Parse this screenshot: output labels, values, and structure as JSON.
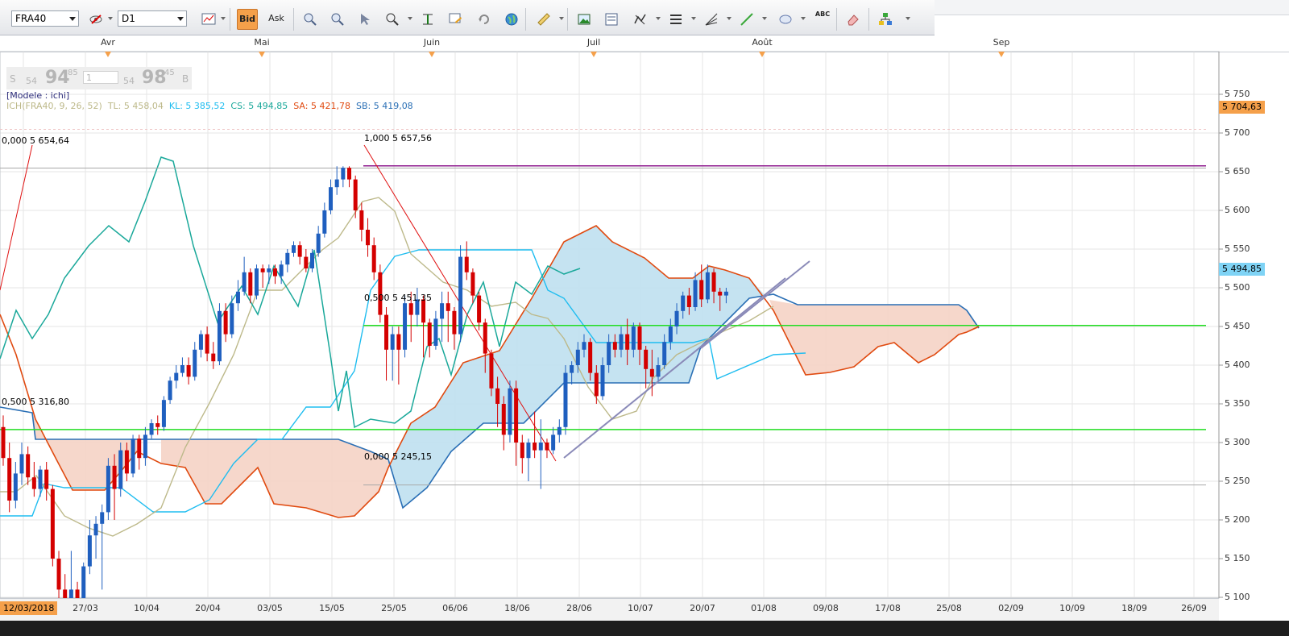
{
  "toolbar": {
    "symbol": "FRA40",
    "timeframe": "D1",
    "bid_label": "Bid",
    "ask_label": "Ask",
    "text_tool_label": "ABC"
  },
  "quote": {
    "sell_letter": "S",
    "sell_prefix": "54",
    "sell_big": "94",
    "sell_sup": "85",
    "qty": "1",
    "buy_prefix": "54",
    "buy_big": "98",
    "buy_sup": "45",
    "buy_letter": "B"
  },
  "model_label": "[Modele : ichi]",
  "indicator": {
    "name": "ICH(FRA40, 9, 26, 52)",
    "tl": "TL: 5 458,04",
    "kl": "KL: 5 385,52",
    "cs": "CS: 5 494,85",
    "sa": "SA: 5 421,78",
    "sb": "SB: 5 419,08"
  },
  "annotations": {
    "fib_top_left": "0,000 5 654,64",
    "fib_mid_left": "0,500 5 316,80",
    "fib_top": "1,000 5 657,56",
    "fib_mid": "0,500 5 451,35",
    "fib_low": "0,000 5 245,15"
  },
  "price_badges": {
    "upper": "5 704,63",
    "current": "5 494,85"
  },
  "months": [
    "Avr",
    "Mai",
    "Juin",
    "Juil",
    "Août",
    "Sep"
  ],
  "dates": [
    "12/03/2018",
    "27/03",
    "10/04",
    "20/04",
    "03/05",
    "15/05",
    "25/05",
    "06/06",
    "18/06",
    "28/06",
    "10/07",
    "20/07",
    "01/08",
    "09/08",
    "17/08",
    "25/08",
    "02/09",
    "10/09",
    "18/09",
    "26/09"
  ],
  "colors": {
    "up_candle": "#1f5fbf",
    "down_candle": "#d40000",
    "tenkan": "#bdb98a",
    "kijun": "#1fbdf0",
    "chikou": "#1aa89a",
    "senkou_a": "#2a6fb5",
    "senkou_b": "#e04a10",
    "kumo_bull": "#bfe0ef",
    "kumo_bear": "#f5d3c5",
    "fib_green": "#22dd22",
    "purple": "#8e1b8e",
    "trend": "#8a8ab8",
    "accent": "#f5a04a"
  },
  "chart_data": {
    "type": "candlestick",
    "symbol": "FRA40",
    "timeframe": "D1",
    "y_ticks": [
      5100,
      5150,
      5200,
      5250,
      5300,
      5350,
      5400,
      5450,
      5500,
      5550,
      5600,
      5650,
      5700,
      5750
    ],
    "y_tick_labels": [
      "5 100",
      "5 150",
      "5 200",
      "5 250",
      "5 300",
      "5 350",
      "5 400",
      "5 450",
      "5 500",
      "5 550",
      "5 600",
      "5 650",
      "5 700",
      "5 750"
    ],
    "ylim": [
      5080,
      5760
    ],
    "candles": [
      {
        "date": "2018-03-12",
        "o": 5320,
        "c": 5280,
        "h": 5335,
        "l": 5270
      },
      {
        "date": "2018-03-13",
        "o": 5280,
        "c": 5225,
        "h": 5300,
        "l": 5210
      },
      {
        "date": "2018-03-14",
        "o": 5225,
        "c": 5260,
        "h": 5275,
        "l": 5215
      },
      {
        "date": "2018-03-15",
        "o": 5260,
        "c": 5285,
        "h": 5300,
        "l": 5245
      },
      {
        "date": "2018-03-16",
        "o": 5285,
        "c": 5255,
        "h": 5295,
        "l": 5245
      },
      {
        "date": "2018-03-19",
        "o": 5255,
        "c": 5240,
        "h": 5275,
        "l": 5230
      },
      {
        "date": "2018-03-20",
        "o": 5240,
        "c": 5265,
        "h": 5270,
        "l": 5230
      },
      {
        "date": "2018-03-21",
        "o": 5265,
        "c": 5240,
        "h": 5275,
        "l": 5225
      },
      {
        "date": "2018-03-22",
        "o": 5240,
        "c": 5150,
        "h": 5245,
        "l": 5140
      },
      {
        "date": "2018-03-23",
        "o": 5150,
        "c": 5110,
        "h": 5160,
        "l": 5095
      },
      {
        "date": "2018-03-26",
        "o": 5110,
        "c": 5085,
        "h": 5130,
        "l": 5070
      },
      {
        "date": "2018-03-27",
        "o": 5085,
        "c": 5110,
        "h": 5160,
        "l": 5080
      },
      {
        "date": "2018-03-28",
        "o": 5110,
        "c": 5085,
        "h": 5120,
        "l": 5070
      },
      {
        "date": "2018-03-29",
        "o": 5085,
        "c": 5140,
        "h": 5145,
        "l": 5080
      },
      {
        "date": "2018-04-03",
        "o": 5140,
        "c": 5180,
        "h": 5200,
        "l": 5130
      },
      {
        "date": "2018-04-04",
        "o": 5180,
        "c": 5195,
        "h": 5205,
        "l": 5150
      },
      {
        "date": "2018-04-05",
        "o": 5195,
        "c": 5210,
        "h": 5220,
        "l": 5110
      },
      {
        "date": "2018-04-06",
        "o": 5210,
        "c": 5270,
        "h": 5280,
        "l": 5200
      },
      {
        "date": "2018-04-09",
        "o": 5270,
        "c": 5240,
        "h": 5285,
        "l": 5200
      },
      {
        "date": "2018-04-10",
        "o": 5240,
        "c": 5290,
        "h": 5300,
        "l": 5230
      },
      {
        "date": "2018-04-11",
        "o": 5290,
        "c": 5260,
        "h": 5300,
        "l": 5250
      },
      {
        "date": "2018-04-12",
        "o": 5260,
        "c": 5305,
        "h": 5310,
        "l": 5255
      },
      {
        "date": "2018-04-13",
        "o": 5305,
        "c": 5280,
        "h": 5310,
        "l": 5265
      },
      {
        "date": "2018-04-16",
        "o": 5280,
        "c": 5310,
        "h": 5320,
        "l": 5270
      },
      {
        "date": "2018-04-17",
        "o": 5310,
        "c": 5325,
        "h": 5330,
        "l": 5305
      },
      {
        "date": "2018-04-18",
        "o": 5325,
        "c": 5320,
        "h": 5335,
        "l": 5310
      },
      {
        "date": "2018-04-19",
        "o": 5320,
        "c": 5355,
        "h": 5360,
        "l": 5315
      },
      {
        "date": "2018-04-20",
        "o": 5355,
        "c": 5380,
        "h": 5385,
        "l": 5350
      },
      {
        "date": "2018-04-23",
        "o": 5380,
        "c": 5390,
        "h": 5400,
        "l": 5370
      },
      {
        "date": "2018-04-24",
        "o": 5390,
        "c": 5400,
        "h": 5410,
        "l": 5385
      },
      {
        "date": "2018-04-25",
        "o": 5400,
        "c": 5385,
        "h": 5410,
        "l": 5375
      },
      {
        "date": "2018-04-26",
        "o": 5385,
        "c": 5420,
        "h": 5430,
        "l": 5380
      },
      {
        "date": "2018-04-27",
        "o": 5420,
        "c": 5440,
        "h": 5445,
        "l": 5410
      },
      {
        "date": "2018-04-30",
        "o": 5440,
        "c": 5415,
        "h": 5450,
        "l": 5405
      },
      {
        "date": "2018-05-01",
        "o": 5415,
        "c": 5405,
        "h": 5430,
        "l": 5395
      },
      {
        "date": "2018-05-02",
        "o": 5405,
        "c": 5470,
        "h": 5480,
        "l": 5400
      },
      {
        "date": "2018-05-03",
        "o": 5470,
        "c": 5440,
        "h": 5480,
        "l": 5430
      },
      {
        "date": "2018-05-04",
        "o": 5440,
        "c": 5480,
        "h": 5490,
        "l": 5435
      },
      {
        "date": "2018-05-07",
        "o": 5480,
        "c": 5495,
        "h": 5510,
        "l": 5470
      },
      {
        "date": "2018-05-08",
        "o": 5495,
        "c": 5520,
        "h": 5540,
        "l": 5490
      },
      {
        "date": "2018-05-09",
        "o": 5520,
        "c": 5490,
        "h": 5525,
        "l": 5480
      },
      {
        "date": "2018-05-10",
        "o": 5490,
        "c": 5525,
        "h": 5530,
        "l": 5485
      },
      {
        "date": "2018-05-11",
        "o": 5525,
        "c": 5520,
        "h": 5530,
        "l": 5500
      },
      {
        "date": "2018-05-14",
        "o": 5520,
        "c": 5525,
        "h": 5530,
        "l": 5505
      },
      {
        "date": "2018-05-15",
        "o": 5525,
        "c": 5515,
        "h": 5530,
        "l": 5505
      },
      {
        "date": "2018-05-16",
        "o": 5515,
        "c": 5530,
        "h": 5535,
        "l": 5505
      },
      {
        "date": "2018-05-17",
        "o": 5530,
        "c": 5545,
        "h": 5550,
        "l": 5520
      },
      {
        "date": "2018-05-18",
        "o": 5545,
        "c": 5555,
        "h": 5560,
        "l": 5540
      },
      {
        "date": "2018-05-21",
        "o": 5555,
        "c": 5540,
        "h": 5560,
        "l": 5530
      },
      {
        "date": "2018-05-22",
        "o": 5540,
        "c": 5525,
        "h": 5550,
        "l": 5520
      },
      {
        "date": "2018-05-23",
        "o": 5525,
        "c": 5545,
        "h": 5550,
        "l": 5520
      },
      {
        "date": "2018-05-24",
        "o": 5545,
        "c": 5570,
        "h": 5580,
        "l": 5540
      },
      {
        "date": "2018-05-25",
        "o": 5570,
        "c": 5600,
        "h": 5610,
        "l": 5565
      },
      {
        "date": "2018-05-28",
        "o": 5600,
        "c": 5630,
        "h": 5640,
        "l": 5595
      },
      {
        "date": "2018-05-29",
        "o": 5630,
        "c": 5640,
        "h": 5657,
        "l": 5620
      },
      {
        "date": "2018-05-30",
        "o": 5640,
        "c": 5655,
        "h": 5657,
        "l": 5630
      },
      {
        "date": "2018-05-31",
        "o": 5655,
        "c": 5640,
        "h": 5657,
        "l": 5630
      },
      {
        "date": "2018-06-01",
        "o": 5640,
        "c": 5600,
        "h": 5645,
        "l": 5590
      },
      {
        "date": "2018-06-04",
        "o": 5600,
        "c": 5575,
        "h": 5610,
        "l": 5560
      },
      {
        "date": "2018-06-05",
        "o": 5575,
        "c": 5555,
        "h": 5590,
        "l": 5540
      },
      {
        "date": "2018-06-06",
        "o": 5555,
        "c": 5520,
        "h": 5565,
        "l": 5510
      },
      {
        "date": "2018-06-07",
        "o": 5520,
        "c": 5465,
        "h": 5530,
        "l": 5455
      },
      {
        "date": "2018-06-08",
        "o": 5465,
        "c": 5420,
        "h": 5475,
        "l": 5380
      },
      {
        "date": "2018-06-11",
        "o": 5420,
        "c": 5440,
        "h": 5450,
        "l": 5380
      },
      {
        "date": "2018-06-12",
        "o": 5440,
        "c": 5420,
        "h": 5450,
        "l": 5375
      },
      {
        "date": "2018-06-13",
        "o": 5420,
        "c": 5480,
        "h": 5490,
        "l": 5410
      },
      {
        "date": "2018-06-14",
        "o": 5480,
        "c": 5465,
        "h": 5495,
        "l": 5430
      },
      {
        "date": "2018-06-15",
        "o": 5465,
        "c": 5485,
        "h": 5500,
        "l": 5450
      },
      {
        "date": "2018-06-18",
        "o": 5485,
        "c": 5455,
        "h": 5490,
        "l": 5410
      },
      {
        "date": "2018-06-19",
        "o": 5455,
        "c": 5425,
        "h": 5460,
        "l": 5410
      },
      {
        "date": "2018-06-20",
        "o": 5425,
        "c": 5460,
        "h": 5470,
        "l": 5420
      },
      {
        "date": "2018-06-21",
        "o": 5460,
        "c": 5480,
        "h": 5495,
        "l": 5430
      },
      {
        "date": "2018-06-22",
        "o": 5480,
        "c": 5470,
        "h": 5495,
        "l": 5430
      },
      {
        "date": "2018-06-25",
        "o": 5470,
        "c": 5440,
        "h": 5475,
        "l": 5420
      },
      {
        "date": "2018-06-26",
        "o": 5440,
        "c": 5540,
        "h": 5555,
        "l": 5430
      },
      {
        "date": "2018-06-27",
        "o": 5540,
        "c": 5520,
        "h": 5560,
        "l": 5510
      },
      {
        "date": "2018-06-28",
        "o": 5520,
        "c": 5490,
        "h": 5525,
        "l": 5480
      },
      {
        "date": "2018-06-29",
        "o": 5490,
        "c": 5455,
        "h": 5495,
        "l": 5445
      },
      {
        "date": "2018-07-02",
        "o": 5455,
        "c": 5415,
        "h": 5460,
        "l": 5390
      },
      {
        "date": "2018-07-03",
        "o": 5415,
        "c": 5370,
        "h": 5420,
        "l": 5360
      },
      {
        "date": "2018-07-04",
        "o": 5370,
        "c": 5350,
        "h": 5385,
        "l": 5320
      },
      {
        "date": "2018-07-05",
        "o": 5350,
        "c": 5310,
        "h": 5360,
        "l": 5290
      },
      {
        "date": "2018-07-06",
        "o": 5310,
        "c": 5370,
        "h": 5380,
        "l": 5300
      },
      {
        "date": "2018-07-09",
        "o": 5370,
        "c": 5300,
        "h": 5380,
        "l": 5270
      },
      {
        "date": "2018-07-10",
        "o": 5300,
        "c": 5280,
        "h": 5310,
        "l": 5260
      },
      {
        "date": "2018-07-11",
        "o": 5280,
        "c": 5300,
        "h": 5305,
        "l": 5250
      },
      {
        "date": "2018-07-12",
        "o": 5300,
        "c": 5290,
        "h": 5340,
        "l": 5280
      },
      {
        "date": "2018-07-13",
        "o": 5290,
        "c": 5300,
        "h": 5330,
        "l": 5240
      },
      {
        "date": "2018-07-16",
        "o": 5300,
        "c": 5290,
        "h": 5305,
        "l": 5280
      },
      {
        "date": "2018-07-17",
        "o": 5290,
        "c": 5310,
        "h": 5320,
        "l": 5285
      },
      {
        "date": "2018-07-18",
        "o": 5310,
        "c": 5320,
        "h": 5330,
        "l": 5300
      },
      {
        "date": "2018-07-19",
        "o": 5320,
        "c": 5390,
        "h": 5400,
        "l": 5310
      },
      {
        "date": "2018-07-20",
        "o": 5390,
        "c": 5400,
        "h": 5405,
        "l": 5375
      },
      {
        "date": "2018-07-23",
        "o": 5400,
        "c": 5420,
        "h": 5430,
        "l": 5390
      },
      {
        "date": "2018-07-24",
        "o": 5420,
        "c": 5430,
        "h": 5440,
        "l": 5410
      },
      {
        "date": "2018-07-25",
        "o": 5430,
        "c": 5390,
        "h": 5435,
        "l": 5380
      },
      {
        "date": "2018-07-26",
        "o": 5390,
        "c": 5360,
        "h": 5400,
        "l": 5350
      },
      {
        "date": "2018-07-27",
        "o": 5360,
        "c": 5400,
        "h": 5410,
        "l": 5355
      },
      {
        "date": "2018-07-30",
        "o": 5400,
        "c": 5430,
        "h": 5440,
        "l": 5390
      },
      {
        "date": "2018-07-31",
        "o": 5430,
        "c": 5420,
        "h": 5440,
        "l": 5410
      },
      {
        "date": "2018-08-01",
        "o": 5420,
        "c": 5440,
        "h": 5450,
        "l": 5410
      },
      {
        "date": "2018-08-02",
        "o": 5440,
        "c": 5420,
        "h": 5460,
        "l": 5400
      },
      {
        "date": "2018-08-03",
        "o": 5420,
        "c": 5450,
        "h": 5455,
        "l": 5410
      },
      {
        "date": "2018-08-06",
        "o": 5450,
        "c": 5420,
        "h": 5455,
        "l": 5400
      },
      {
        "date": "2018-08-07",
        "o": 5420,
        "c": 5395,
        "h": 5425,
        "l": 5370
      },
      {
        "date": "2018-08-08",
        "o": 5395,
        "c": 5385,
        "h": 5420,
        "l": 5360
      },
      {
        "date": "2018-08-09",
        "o": 5385,
        "c": 5400,
        "h": 5410,
        "l": 5380
      },
      {
        "date": "2018-08-10",
        "o": 5400,
        "c": 5430,
        "h": 5440,
        "l": 5395
      },
      {
        "date": "2018-08-13",
        "o": 5430,
        "c": 5450,
        "h": 5460,
        "l": 5420
      },
      {
        "date": "2018-08-14",
        "o": 5450,
        "c": 5470,
        "h": 5480,
        "l": 5440
      },
      {
        "date": "2018-08-15",
        "o": 5470,
        "c": 5490,
        "h": 5495,
        "l": 5460
      },
      {
        "date": "2018-08-16",
        "o": 5490,
        "c": 5475,
        "h": 5500,
        "l": 5465
      },
      {
        "date": "2018-08-17",
        "o": 5475,
        "c": 5510,
        "h": 5520,
        "l": 5470
      },
      {
        "date": "2018-08-20",
        "o": 5510,
        "c": 5485,
        "h": 5530,
        "l": 5475
      },
      {
        "date": "2018-08-21",
        "o": 5485,
        "c": 5520,
        "h": 5530,
        "l": 5480
      },
      {
        "date": "2018-08-22",
        "o": 5520,
        "c": 5495,
        "h": 5525,
        "l": 5480
      },
      {
        "date": "2018-08-23",
        "o": 5495,
        "c": 5490,
        "h": 5500,
        "l": 5470
      },
      {
        "date": "2018-08-24",
        "o": 5490,
        "c": 5495,
        "h": 5500,
        "l": 5480
      }
    ],
    "fib_levels": [
      {
        "label": "0,000 5 654,64",
        "value": 5654.64,
        "color": "#999999"
      },
      {
        "label": "0,500 5 316,80",
        "value": 5316.8,
        "color": "#22dd22"
      },
      {
        "label": "1,000 5 657,56",
        "value": 5657.56,
        "color": "#8e1b8e"
      },
      {
        "label": "0,500 5 451,35",
        "value": 5451.35,
        "color": "#22dd22"
      },
      {
        "label": "0,000 5 245,15",
        "value": 5245.15,
        "color": "#999999"
      }
    ],
    "indicator_values": {
      "TL": 5458.04,
      "KL": 5385.52,
      "CS": 5494.85,
      "SA": 5421.78,
      "SB": 5419.08
    }
  }
}
